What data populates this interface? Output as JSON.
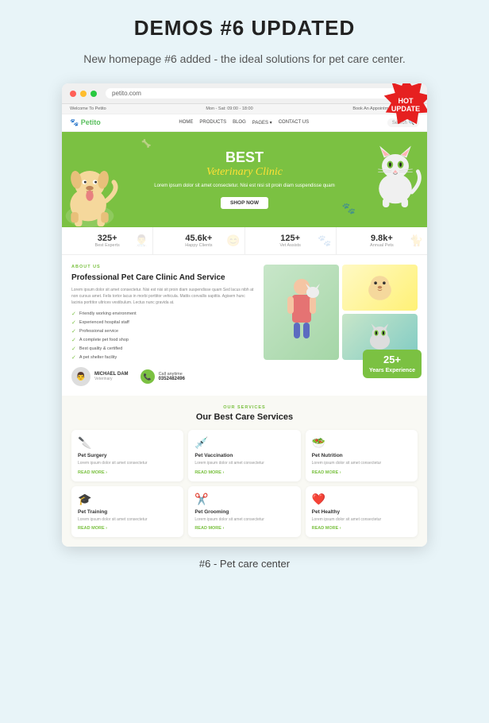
{
  "header": {
    "title": "DEMOS #6 UPDATED",
    "subtitle": "New homepage #6 added - the ideal solutions for pet care center."
  },
  "hot_badge": {
    "line1": "HOT",
    "line2": "UPDATE"
  },
  "topbar": {
    "left": "Welcome To Petito",
    "center": "Mon - Sat: 09:00 - 18:00",
    "right": "Book An Appointment Every Week"
  },
  "nav": {
    "logo": "🐾 Petito",
    "links": [
      "HOME",
      "PRODUCTS",
      "BLOG",
      "PAGES",
      "CONTACT US"
    ],
    "search_placeholder": "Search..."
  },
  "hero": {
    "title": "BEST",
    "script_title": "Veterinary Clinic",
    "description": "Lorem ipsum dolor sit amet consectetur. Nisi est nisi sit proin diam suspendisse quam",
    "cta": "SHOP NOW"
  },
  "stats": [
    {
      "number": "325+",
      "label": "Best Experts",
      "icon": "👨‍⚕️"
    },
    {
      "number": "45.6k+",
      "label": "Happy Clients",
      "icon": "😊"
    },
    {
      "number": "125+",
      "label": "Vet Assists",
      "icon": "🐾"
    },
    {
      "number": "9.8k+",
      "label": "Annual Pets",
      "icon": "🐈"
    }
  ],
  "about": {
    "tag": "ABOUT US",
    "title": "Professional Pet Care Clinic And Service",
    "description": "Lorem ipsum dolor sit amet consectetur. Nisi est nisi sit proin diam suspendisse quam Sed lacus nibh at non cursus amet. Felis tortor lacus in morbi porttitor vehicula. Mattis convallis sapittis. Agisem hunc lacinia porttitor ultrices vestibulum. Lectus nunc gravida at.",
    "features": [
      "Friendly working environment",
      "Experienced hospital staff",
      "Professional service",
      "A complete pet food shop",
      "Best quality & certified",
      "A pet shelter facility"
    ],
    "vet": {
      "name": "MICHAEL DAM",
      "title": "Veterinary"
    },
    "call": {
      "label": "Call anytime",
      "number": "0352482496"
    },
    "experience": {
      "number": "25+",
      "label": "Years Experience"
    }
  },
  "services": {
    "tag": "OUR SERVICES",
    "title": "Our Best Care Services",
    "items": [
      {
        "icon": "🔪",
        "name": "Pet Surgery",
        "description": "Lorem ipsum dolor sit amet consectetur",
        "read_more": "READ MORE ›"
      },
      {
        "icon": "💉",
        "name": "Pet Vaccination",
        "description": "Lorem ipsum dolor sit amet consectetur",
        "read_more": "READ MORE ›"
      },
      {
        "icon": "🥗",
        "name": "Pet Nutrition",
        "description": "Lorem ipsum dolor sit amet consectetur",
        "read_more": "READ MORE ›"
      },
      {
        "icon": "🎓",
        "name": "Pet Training",
        "description": "Lorem ipsum dolor sit amet consectetur",
        "read_more": "READ MORE ›"
      },
      {
        "icon": "✂️",
        "name": "Pet Grooming",
        "description": "Lorem ipsum dolor sit amet consectetur",
        "read_more": "READ MORE ›"
      },
      {
        "icon": "❤️",
        "name": "Pet Healthy",
        "description": "Lorem ipsum dolor sit amet consectetur",
        "read_more": "READ MORE ›"
      }
    ]
  },
  "caption": "#6 - Pet care center"
}
